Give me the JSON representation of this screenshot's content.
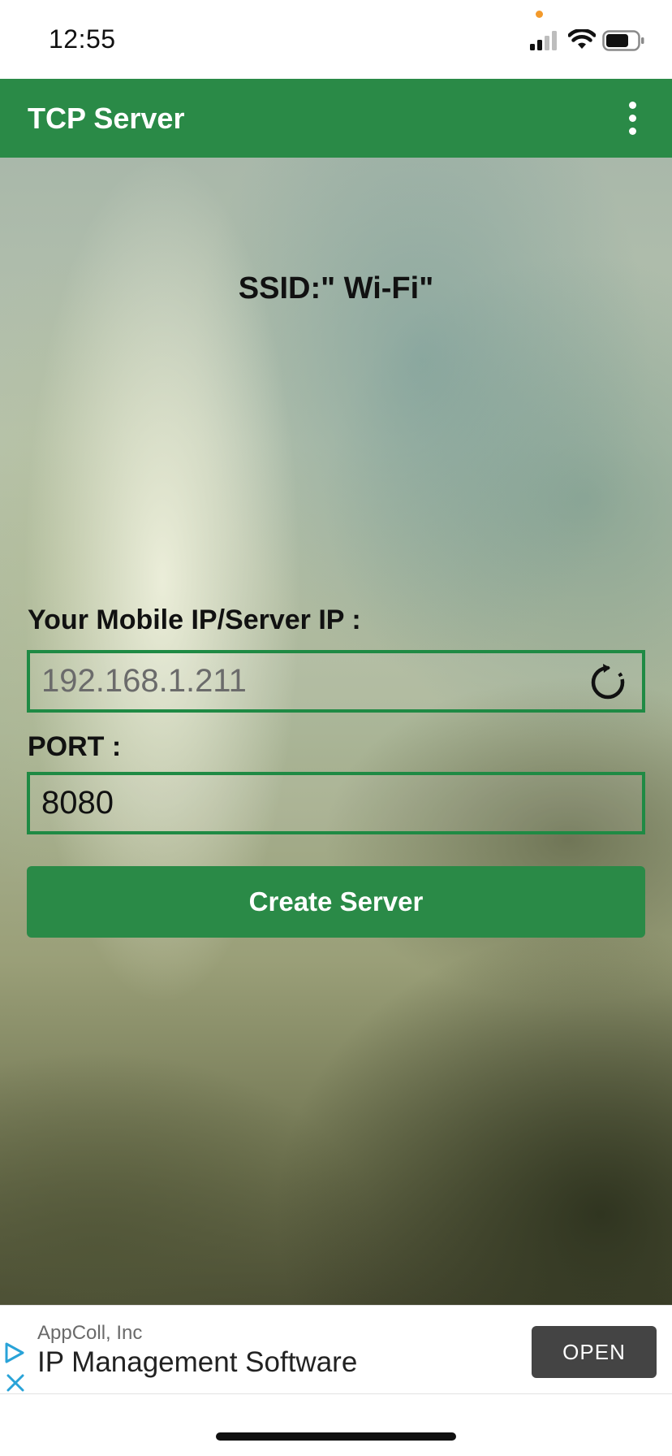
{
  "status_bar": {
    "time": "12:55",
    "signal_icon": "cellular-signal-icon",
    "wifi_icon": "wifi-icon",
    "battery_icon": "battery-icon",
    "privacy_dot_color": "#f39a2b"
  },
  "app_bar": {
    "title": "TCP Server",
    "menu_icon": "more-vertical-icon",
    "color": "#2a8a47"
  },
  "main": {
    "ssid": "SSID:\" Wi-Fi\"",
    "ip_label": "Your Mobile IP/Server IP :",
    "ip_placeholder": "192.168.1.211",
    "refresh_icon": "refresh-icon",
    "port_label": "PORT :",
    "port_value": "8080",
    "create_button": "Create Server",
    "accent_color": "#1f8a44"
  },
  "ad": {
    "advertiser": "AppColl, Inc",
    "headline": "IP Management Software",
    "open_button": "OPEN",
    "ad_choices_icon": "ad-play-icon",
    "close_icon": "close-icon"
  }
}
